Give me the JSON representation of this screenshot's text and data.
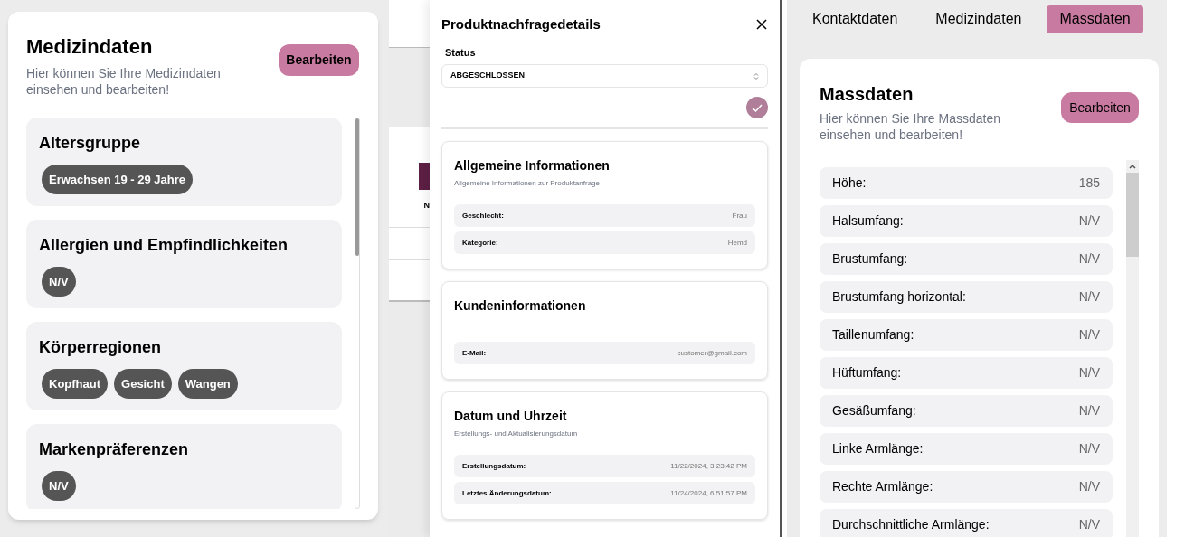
{
  "medical_panel": {
    "title": "Medizindaten",
    "subtitle": "Hier können Sie Ihre Medizindaten einsehen und bearbeiten!",
    "edit_button": "Bearbeiten",
    "sections": [
      {
        "title": "Altersgruppe",
        "chips": [
          "Erwachsen 19 - 29 Jahre"
        ]
      },
      {
        "title": "Allergien und Empfindlichkeiten",
        "chips": [
          "N/V"
        ]
      },
      {
        "title": "Körperregionen",
        "chips": [
          "Kopfhaut",
          "Gesicht",
          "Wangen"
        ]
      },
      {
        "title": "Markenpräferenzen",
        "chips": [
          "N/V"
        ]
      }
    ]
  },
  "background_page": {
    "cut_text": "N"
  },
  "inquiry_dialog": {
    "title": "Produktnachfragedetails",
    "status_label": "Status",
    "status_value": "ABGESCHLOSSEN",
    "sections": [
      {
        "title": "Allgemeine Informationen",
        "subtitle": "Allgemeine Informationen zur Produktanfrage",
        "rows": [
          {
            "label": "Geschlecht:",
            "value": "Frau"
          },
          {
            "label": "Kategorie:",
            "value": "Hemd"
          }
        ]
      },
      {
        "title": "Kundeninformationen",
        "rows": [
          {
            "label": "E-Mail:",
            "value": "customer@gmail.com"
          }
        ]
      },
      {
        "title": "Datum und Uhrzeit",
        "subtitle": "Erstellungs- und Aktualisierungsdatum",
        "rows": [
          {
            "label": "Erstellungsdatum:",
            "value": "11/22/2024, 3:23:42 PM"
          },
          {
            "label": "Letztes Änderungsdatum:",
            "value": "11/24/2024, 6:51:57 PM"
          }
        ]
      }
    ]
  },
  "profile_panel": {
    "tabs": [
      {
        "label": "Kontaktdaten",
        "selected": false
      },
      {
        "label": "Medizindaten",
        "selected": false
      },
      {
        "label": "Massdaten",
        "selected": true
      }
    ],
    "title": "Massdaten",
    "subtitle": "Hier können Sie Ihre Massdaten einsehen und bearbeiten!",
    "edit_button": "Bearbeiten",
    "rows": [
      {
        "label": "Höhe:",
        "value": "185"
      },
      {
        "label": "Halsumfang:",
        "value": "N/V"
      },
      {
        "label": "Brustumfang:",
        "value": "N/V"
      },
      {
        "label": "Brustumfang horizontal:",
        "value": "N/V"
      },
      {
        "label": "Taillenumfang:",
        "value": "N/V"
      },
      {
        "label": "Hüftumfang:",
        "value": "N/V"
      },
      {
        "label": "Gesäßumfang:",
        "value": "N/V"
      },
      {
        "label": "Linke Armlänge:",
        "value": "N/V"
      },
      {
        "label": "Rechte Armlänge:",
        "value": "N/V"
      },
      {
        "label": "Durchschnittliche Armlänge:",
        "value": "N/V"
      }
    ]
  }
}
